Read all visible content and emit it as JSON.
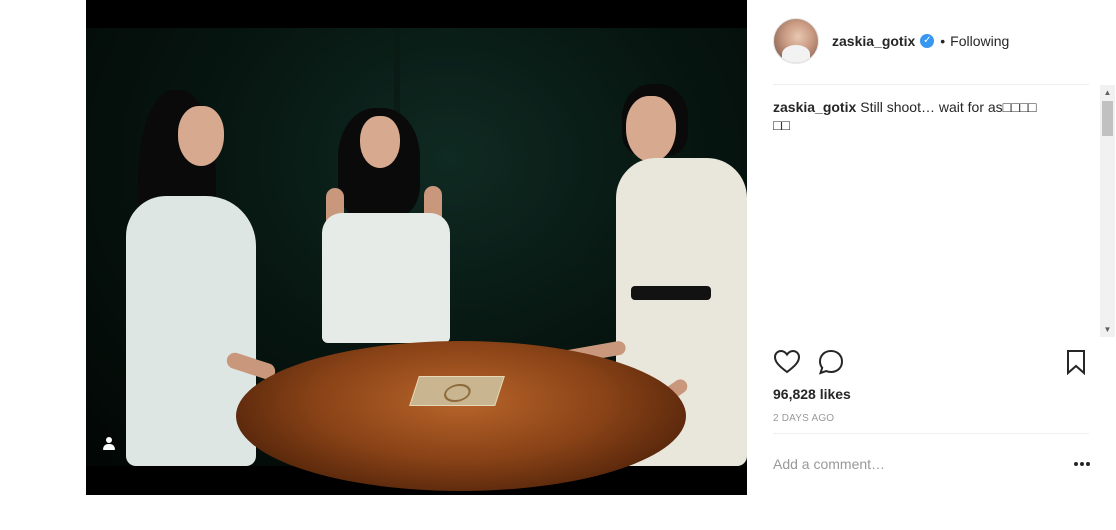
{
  "post": {
    "username": "zaskia_gotix",
    "verified_icon": "verified-badge-icon",
    "separator": "•",
    "follow_state": "Following",
    "caption_user": "zaskia_gotix",
    "caption_text": "Still shoot… wait for as□□□□\n□□",
    "likes": "96,828 likes",
    "time": "2 DAYS AGO",
    "comment_placeholder": "Add a comment…"
  },
  "icons": {
    "like": "heart-icon",
    "comment": "comment-bubble-icon",
    "save": "bookmark-icon",
    "more": "more-options-icon",
    "tagged": "user-tag-icon"
  },
  "colors": {
    "verified": "#3897f0",
    "text": "#262626",
    "muted": "#999999"
  }
}
